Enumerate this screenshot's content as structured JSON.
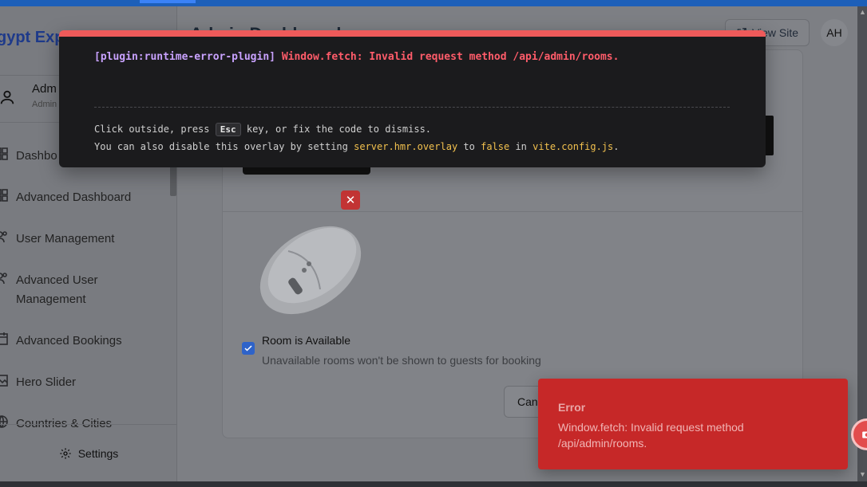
{
  "app": {
    "brand": "gypt Exp",
    "page_title": "Admin Dashboard"
  },
  "header": {
    "view_site_label": "View Site",
    "avatar_initials": "AH"
  },
  "user": {
    "name": "Adm",
    "role": "Admin"
  },
  "sidebar": {
    "items": [
      {
        "label": "Dashbo",
        "icon": "grid-icon"
      },
      {
        "label": "Advanced Dashboard",
        "icon": "grid-icon"
      },
      {
        "label": "User Management",
        "icon": "users-icon"
      },
      {
        "label": "Advanced User Management",
        "icon": "users-icon"
      },
      {
        "label": "Advanced Bookings",
        "icon": "calendar-icon"
      },
      {
        "label": "Hero Slider",
        "icon": "image-icon"
      },
      {
        "label": "Countries & Cities",
        "icon": "globe-icon"
      }
    ],
    "settings_label": "Settings"
  },
  "form": {
    "available_label": "Room is Available",
    "available_checked": true,
    "available_help": "Unavailable rooms won't be shown to guests for booking",
    "cancel_label": "Cancel"
  },
  "error_overlay": {
    "plugin": "[plugin:runtime-error-plugin]",
    "message": "Window.fetch: Invalid request method /api/admin/rooms.",
    "tip_prefix": "Click outside, press",
    "tip_key": "Esc",
    "tip_suffix": "key, or fix the code to dismiss.",
    "tip2_prefix": "You can also disable this overlay by setting",
    "tip2_code": "server.hmr.overlay",
    "tip2_mid": "to",
    "tip2_value": "false",
    "tip2_in": "in",
    "tip2_file": "vite.config.js",
    "tip2_end": "."
  },
  "toast": {
    "title": "Error",
    "message": "Window.fetch: Invalid request method /api/admin/rooms."
  },
  "colors": {
    "overlay_accent": "#ee5a5a",
    "toast_bg": "#c62828",
    "checkbox": "#2e63c9"
  }
}
